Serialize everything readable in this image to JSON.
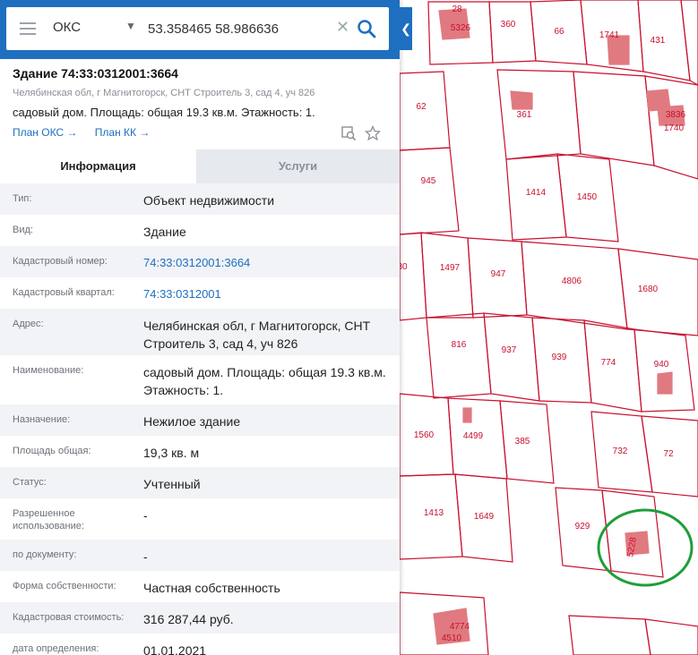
{
  "search": {
    "type_label": "ОКС",
    "query": "53.358465 58.986636"
  },
  "object": {
    "title": "Здание 74:33:0312001:3664",
    "address": "Челябинская обл, г Магнитогорск, СНТ Строитель 3, сад 4, уч 826",
    "description": "садовый дом. Площадь: общая 19.3 кв.м. Этажность: 1.",
    "links": [
      "План ОКС →",
      "План КК →"
    ]
  },
  "tabs": [
    {
      "label": "Информация",
      "active": true
    },
    {
      "label": "Услуги",
      "active": false
    }
  ],
  "attributes": [
    {
      "label": "Тип:",
      "value": "Объект недвижимости"
    },
    {
      "label": "Вид:",
      "value": "Здание"
    },
    {
      "label": "Кадастровый номер:",
      "value": "74:33:0312001:3664",
      "link": true
    },
    {
      "label": "Кадастровый квартал:",
      "value": "74:33:0312001",
      "link": true
    },
    {
      "label": "Адрес:",
      "value": "Челябинская обл, г Магнитогорск, СНТ Строитель 3, сад 4, уч 826"
    },
    {
      "label": "Наименование:",
      "value": "садовый дом. Площадь: общая 19.3 кв.м. Этажность: 1."
    },
    {
      "label": "Назначение:",
      "value": "Нежилое здание"
    },
    {
      "label": "Площадь общая:",
      "value": "19,3 кв. м"
    },
    {
      "label": "Статус:",
      "value": "Учтенный"
    },
    {
      "label": "Разрешенное использование:",
      "value": "-"
    },
    {
      "label": "по документу:",
      "value": "-"
    },
    {
      "label": "Форма собственности:",
      "value": "Частная собственность"
    },
    {
      "label": "Кадастровая стоимость:",
      "value": "316 287,44 руб."
    },
    {
      "label": "дата определения:",
      "value": "01.01.2021"
    }
  ],
  "map": {
    "parcel_labels": [
      "28",
      "5326",
      "360",
      "66",
      "1741",
      "431",
      "62",
      "361",
      "3836",
      "1740",
      "945",
      "1414",
      "1450",
      "80",
      "1497",
      "947",
      "4806",
      "1680",
      "816",
      "937",
      "939",
      "774",
      "940",
      "1560",
      "4499",
      "385",
      "732",
      "72",
      "1413",
      "1649",
      "929",
      "5228",
      "4774",
      "4510"
    ],
    "parcel_color": "#c8102e",
    "building_color": "#e07a80",
    "highlight_color": "#1f9e3a"
  }
}
